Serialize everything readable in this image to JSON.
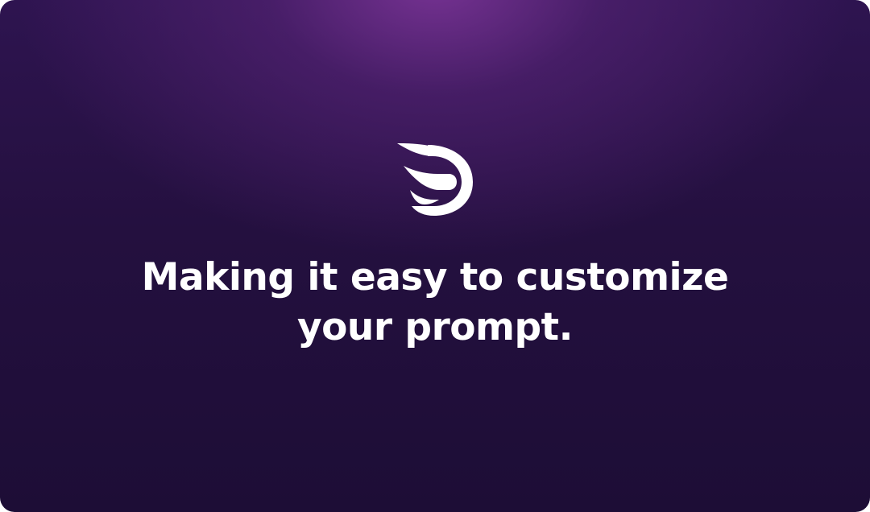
{
  "hero": {
    "logo_icon": "brand-d-logo-icon",
    "headline_line1": "Making it easy to customize",
    "headline_line2": "your prompt."
  },
  "colors": {
    "background_top": "#2e1450",
    "background_bottom": "#1d0d36",
    "glow": "#7a3496",
    "text": "#ffffff"
  }
}
